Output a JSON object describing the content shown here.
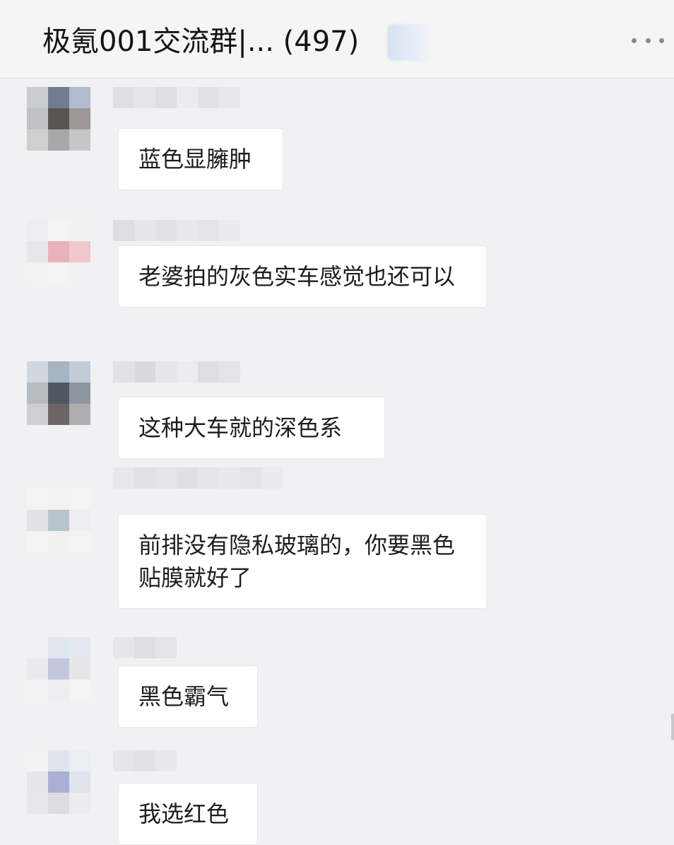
{
  "header": {
    "title": "极氪001交流群|... (497)",
    "more_icon": "more-horizontal-icon"
  },
  "messages": [
    {
      "text": "蓝色显臃肿"
    },
    {
      "text": "老婆拍的灰色实车感觉也还可以"
    },
    {
      "text": "这种大车就的深色系"
    },
    {
      "text": "前排没有隐私玻璃的，你要黑色贴膜就好了"
    },
    {
      "text": "黑色霸气"
    },
    {
      "text": "我选红色"
    }
  ]
}
